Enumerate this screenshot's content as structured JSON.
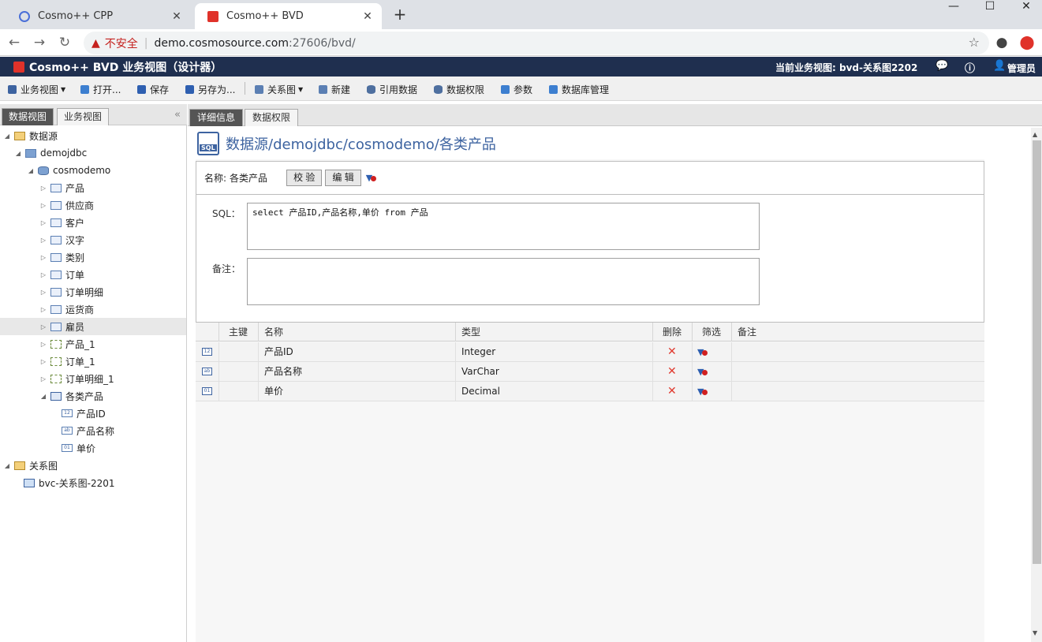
{
  "browser": {
    "tabs": [
      {
        "label": "Cosmo++ CPP",
        "active": false
      },
      {
        "label": "Cosmo++ BVD",
        "active": true
      }
    ],
    "new_tab": "+",
    "window_controls": [
      "—",
      "☐",
      "✕"
    ],
    "insecure_label": "不安全",
    "url_host": "demo.cosmosource.com",
    "url_port_path": ":27606/bvd/"
  },
  "app": {
    "title": "Cosmo++ BVD 业务视图（设计器）",
    "current_view": "当前业务视图: bvd-关系图2202",
    "user": "管理员"
  },
  "toolbar": {
    "items": [
      {
        "label": "业务视图",
        "dropdown": true,
        "icon": "view-icon"
      },
      {
        "label": "打开...",
        "dropdown": false,
        "icon": "open-folder-icon"
      },
      {
        "label": "保存",
        "dropdown": false,
        "icon": "save-icon"
      },
      {
        "label": "另存为...",
        "dropdown": false,
        "icon": "save-as-icon"
      },
      {
        "label": "关系图",
        "dropdown": true,
        "icon": "relation-diagram-icon"
      },
      {
        "label": "新建",
        "dropdown": false,
        "icon": "new-icon"
      },
      {
        "label": "引用数据",
        "dropdown": false,
        "icon": "reference-data-icon"
      },
      {
        "label": "数据权限",
        "dropdown": false,
        "icon": "data-permission-icon"
      },
      {
        "label": "参数",
        "dropdown": false,
        "icon": "parameter-icon"
      },
      {
        "label": "数据库管理",
        "dropdown": false,
        "icon": "database-admin-icon"
      }
    ]
  },
  "left_panel": {
    "tabs": [
      "数据视图",
      "业务视图"
    ],
    "tree": [
      {
        "label": "数据源",
        "level": 0,
        "expanded": true,
        "icon": "folder"
      },
      {
        "label": "demojdbc",
        "level": 1,
        "expanded": true,
        "icon": "datasource"
      },
      {
        "label": "cosmodemo",
        "level": 2,
        "expanded": true,
        "icon": "db"
      },
      {
        "label": "产品",
        "level": 3,
        "expanded": false,
        "icon": "table"
      },
      {
        "label": "供应商",
        "level": 3,
        "expanded": false,
        "icon": "table"
      },
      {
        "label": "客户",
        "level": 3,
        "expanded": false,
        "icon": "table"
      },
      {
        "label": "汉字",
        "level": 3,
        "expanded": false,
        "icon": "table"
      },
      {
        "label": "类别",
        "level": 3,
        "expanded": false,
        "icon": "table"
      },
      {
        "label": "订单",
        "level": 3,
        "expanded": false,
        "icon": "table"
      },
      {
        "label": "订单明细",
        "level": 3,
        "expanded": false,
        "icon": "table"
      },
      {
        "label": "运货商",
        "level": 3,
        "expanded": false,
        "icon": "table"
      },
      {
        "label": "雇员",
        "level": 3,
        "expanded": false,
        "icon": "table",
        "selected": true
      },
      {
        "label": "产品_1",
        "level": 3,
        "expanded": false,
        "icon": "view"
      },
      {
        "label": "订单_1",
        "level": 3,
        "expanded": false,
        "icon": "view"
      },
      {
        "label": "订单明细_1",
        "level": 3,
        "expanded": false,
        "icon": "view"
      },
      {
        "label": "各类产品",
        "level": 3,
        "expanded": true,
        "icon": "sql"
      },
      {
        "label": "产品ID",
        "level": 4,
        "icon": "col",
        "badge": "12"
      },
      {
        "label": "产品名称",
        "level": 4,
        "icon": "col",
        "badge": "ab"
      },
      {
        "label": "单价",
        "level": 4,
        "icon": "col",
        "badge": "01"
      },
      {
        "label": "关系图",
        "level": 0,
        "expanded": true,
        "icon": "folder"
      },
      {
        "label": "bvc-关系图-2201",
        "level": 1,
        "icon": "relation"
      }
    ]
  },
  "right_panel": {
    "tabs": [
      "详细信息",
      "数据权限"
    ],
    "heading": "数据源/demojdbc/cosmodemo/各类产品",
    "sql_icon_text": "SQL",
    "name_label": "名称:",
    "name_value": "各类产品",
    "validate_button": "校 验",
    "edit_button": "编 辑",
    "sql_label": "SQL：",
    "sql_value": "select 产品ID,产品名称,单价 from 产品",
    "remark_label": "备注：",
    "remark_value": "",
    "grid": {
      "headers": [
        "",
        "主键",
        "名称",
        "类型",
        "删除",
        "筛选",
        "备注"
      ],
      "rows": [
        {
          "badge": "12",
          "pk": "",
          "name": "产品ID",
          "type": "Integer",
          "remark": ""
        },
        {
          "badge": "ab",
          "pk": "",
          "name": "产品名称",
          "type": "VarChar",
          "remark": ""
        },
        {
          "badge": "01",
          "pk": "",
          "name": "单价",
          "type": "Decimal",
          "remark": ""
        }
      ]
    }
  },
  "colors": {
    "app_header": "#1f2f4f",
    "accent_blue": "#3d63a0",
    "delete_red": "#e03a2f"
  }
}
